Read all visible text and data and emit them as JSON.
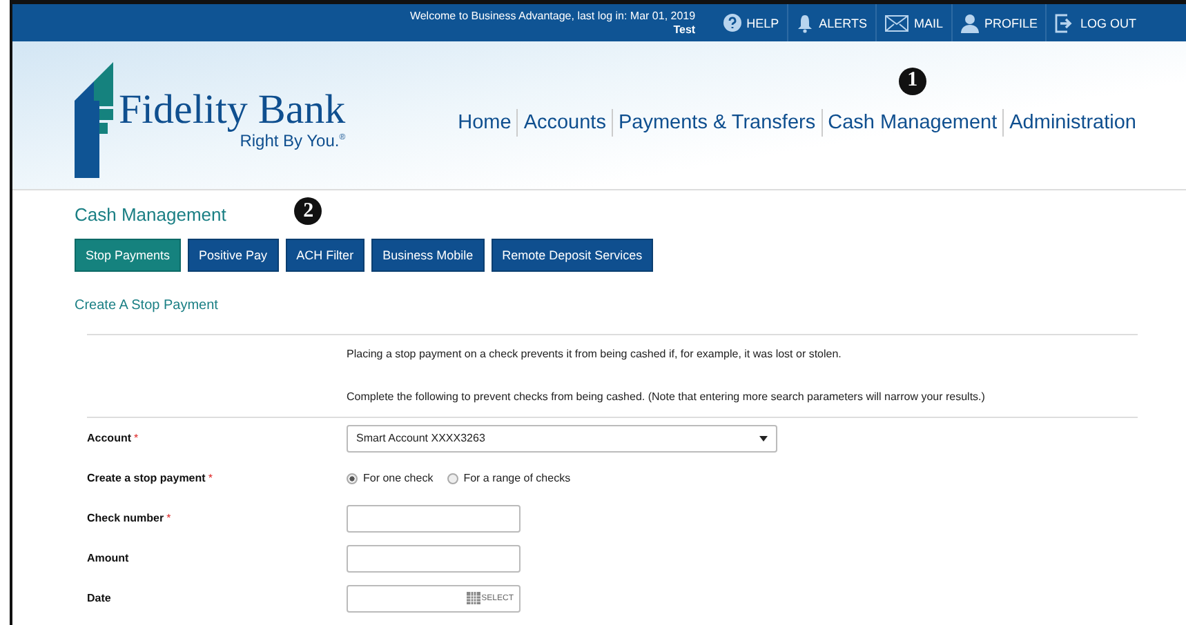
{
  "top_bar": {
    "welcome": "Welcome to Business Advantage, last log in: Mar 01, 2019",
    "user": "Test",
    "links": [
      {
        "label": "HELP",
        "kind": "help"
      },
      {
        "label": "ALERTS",
        "kind": "bell"
      },
      {
        "label": "MAIL",
        "kind": "mail"
      },
      {
        "label": "PROFILE",
        "kind": "person"
      },
      {
        "label": "LOG OUT",
        "kind": "logout"
      }
    ]
  },
  "logo": {
    "name": "Fidelity Bank",
    "tagline": "Right By You.$^{®}$"
  },
  "nav": [
    {
      "label": "Home"
    },
    {
      "label": "Accounts"
    },
    {
      "label": "Payments & Transfers"
    },
    {
      "label": "Cash Management",
      "callout": "1"
    },
    {
      "label": "Administration"
    }
  ],
  "section_title": "Cash Management",
  "tabs": [
    {
      "label": "Stop Payments",
      "selected": true
    },
    {
      "label": "Positive Pay",
      "selected": false
    },
    {
      "label": "ACH Filter",
      "selected": false,
      "callout": "2"
    },
    {
      "label": "Business Mobile",
      "selected": false
    },
    {
      "label": "Remote Deposit Services",
      "selected": false
    }
  ],
  "subtitle": "Create A Stop Payment",
  "intro": [
    "Placing a stop payment on a check prevents it from being cashed if, for example, it was lost or stolen.",
    "Complete the following to prevent checks from being cashed. (Note that entering more search parameters will narrow your results.)"
  ],
  "form": [
    {
      "label": "Account",
      "required_mark": "*",
      "kind": "select",
      "value": "Smart Account XXXX3263"
    },
    {
      "label": "Create a stop payment",
      "required_mark": "*",
      "kind": "radio",
      "options": [
        {
          "label": "For one check",
          "selected": true
        },
        {
          "label": "For a range of checks",
          "selected": false
        }
      ]
    },
    {
      "label": "Check number",
      "required_mark": "*",
      "kind": "text"
    },
    {
      "label": "Amount",
      "kind": "text"
    },
    {
      "label": "Date",
      "kind": "date",
      "button": "SELECT"
    }
  ]
}
